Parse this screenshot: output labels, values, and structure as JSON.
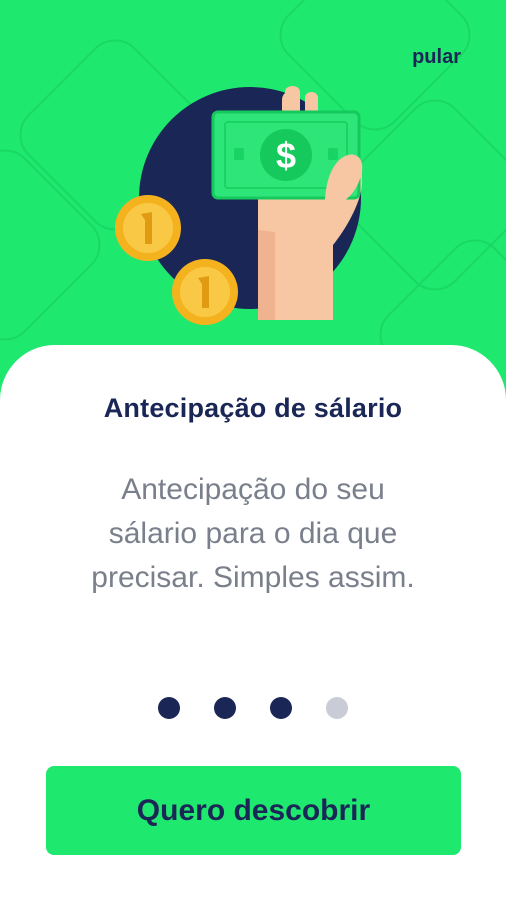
{
  "header": {
    "skip_label": "pular"
  },
  "onboarding": {
    "title": "Antecipação de sálario",
    "description_lines": [
      "Antecipação do seu",
      "sálario para o dia que",
      "precisar. Simples assim."
    ],
    "pagination": {
      "total": 4,
      "active": [
        0,
        1,
        2
      ]
    },
    "cta_label": "Quero descobrir"
  },
  "illustration": {
    "banknote_symbol": "$",
    "icons": [
      "hand-holding-banknote-icon",
      "coin-icon"
    ]
  },
  "colors": {
    "brand_green": "#1fe86f",
    "navy": "#1a2756",
    "text_gray": "#7a7f8c",
    "dot_inactive": "#c9ccd6"
  }
}
